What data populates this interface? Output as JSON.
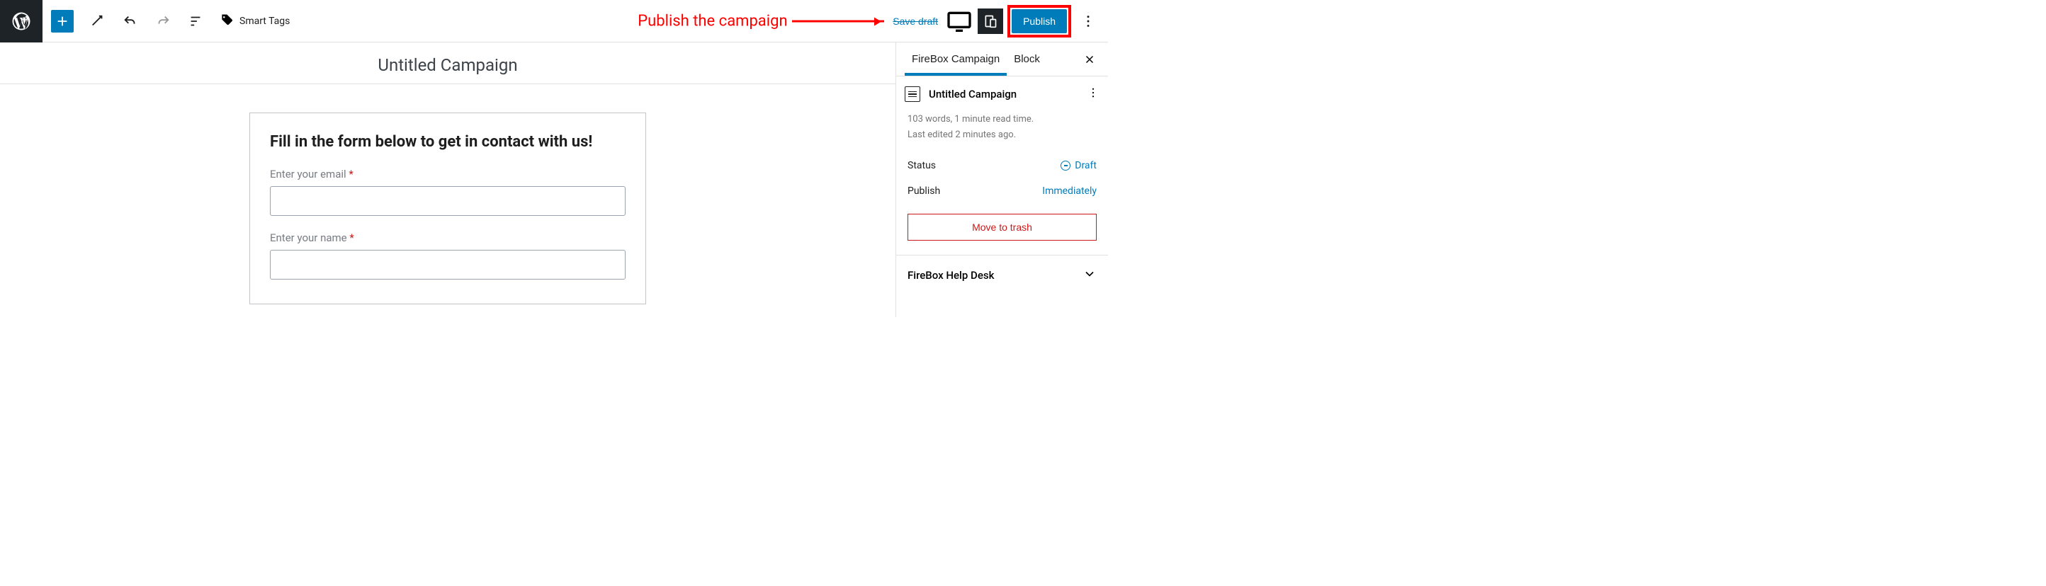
{
  "toolbar": {
    "smart_tags_label": "Smart Tags",
    "save_draft_label": "Save draft",
    "publish_label": "Publish"
  },
  "annotation": {
    "text": "Publish the campaign"
  },
  "editor": {
    "page_title": "Untitled Campaign",
    "form": {
      "heading": "Fill in the form below to get in contact with us!",
      "email_label": "Enter your email",
      "name_label": "Enter your name",
      "required_mark": "*"
    }
  },
  "sidebar": {
    "tabs": {
      "firebox": "FireBox Campaign",
      "block": "Block"
    },
    "doc_title": "Untitled Campaign",
    "meta_words": "103 words, 1 minute read time.",
    "meta_edited": "Last edited 2 minutes ago.",
    "status_label": "Status",
    "status_value": "Draft",
    "publish_label": "Publish",
    "publish_value": "Immediately",
    "trash_label": "Move to trash",
    "help_desk_label": "FireBox Help Desk"
  }
}
